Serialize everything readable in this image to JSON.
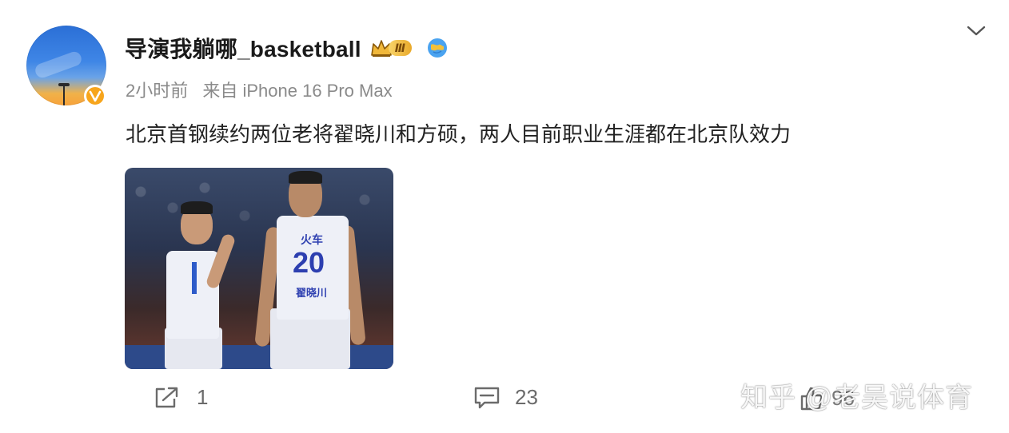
{
  "post": {
    "username": "导演我躺哪_basketball",
    "vip_level": "Ⅲ",
    "time": "2小时前",
    "source": "来自 iPhone 16 Pro Max",
    "text": "北京首钢续约两位老将翟晓川和方硕，两人目前职业生涯都在北京队效力",
    "image": {
      "jersey_number": "20",
      "jersey_top_text": "火车",
      "jersey_bottom_text": "翟晓川"
    }
  },
  "actions": {
    "repost_count": "1",
    "comment_count": "23",
    "like_count": "96"
  },
  "watermark": "知乎 @老吴说体育",
  "colors": {
    "verified_badge": "#f7a51c",
    "vip_gold": "#e9a92a",
    "text_primary": "#222222",
    "text_meta": "#8a8a8a"
  },
  "icons": {
    "menu": "chevron-down-icon",
    "repost": "repost-icon",
    "comment": "comment-icon",
    "like": "thumbs-up-icon",
    "verified": "verified-v-icon",
    "vip": "crown-icon",
    "globe": "globe-icon"
  }
}
